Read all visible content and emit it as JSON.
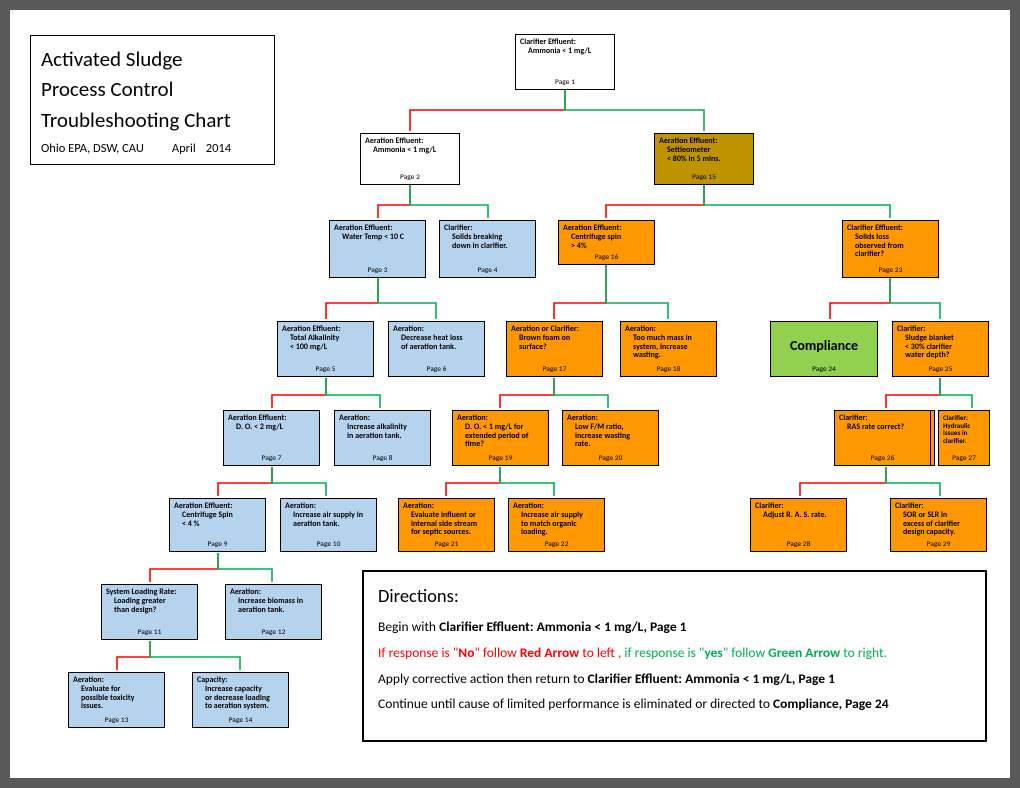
{
  "title": {
    "line1": "Activated Sludge",
    "line2": "Process Control",
    "line3": "Troubleshooting Chart",
    "sub_org": "Ohio EPA, DSW, CAU",
    "sub_month": "April",
    "sub_year": "2014"
  },
  "nodes": {
    "p1": {
      "hdr": "Clarifier Effluent:",
      "bd": "Ammonia < 1 mg/L",
      "pg": "Page 1"
    },
    "p2": {
      "hdr": "Aeration Effluent:",
      "bd": "Ammonia < 1 mg/L",
      "pg": "Page 2"
    },
    "p15": {
      "hdr": "Aeration Effluent:",
      "bd": "Settleometer",
      "bd2": "< 80% in 5 mins.",
      "pg": "Page 15"
    },
    "p3": {
      "hdr": "Aeration Effluent:",
      "bd": "Water Temp < 10 C",
      "pg": "Page 3"
    },
    "p4": {
      "hdr": "Clarifier:",
      "bd": "Solids breaking",
      "bd2": "down in clarifier.",
      "pg": "Page 4"
    },
    "p16": {
      "hdr": "Aeration Effluent:",
      "bd": "Centrifuge spin",
      "bd2": "> 4%",
      "pg": "Page 16"
    },
    "p23": {
      "hdr": "Clarifier Effluent:",
      "bd": "Solids loss",
      "bd2": "observed from",
      "bd3": "clarifier?",
      "pg": "Page 23"
    },
    "p5": {
      "hdr": "Aeration Effluent:",
      "bd": "Total Alkalinity",
      "bd2": "< 100 mg/L",
      "pg": "Page 5"
    },
    "p6": {
      "hdr": "Aeration:",
      "bd": "Decrease heat loss",
      "bd2": "of aeration tank.",
      "pg": "Page 6"
    },
    "p17": {
      "hdr": "Aeration or Clarifier:",
      "bd": "Brown foam on",
      "bd2": "surface?",
      "pg": "Page 17"
    },
    "p18": {
      "hdr": "Aeration:",
      "bd": "Too much mass in",
      "bd2": "system, increase",
      "bd3": "wasting.",
      "pg": "Page 18"
    },
    "p24": {
      "label": "Compliance",
      "pg": "Page 24"
    },
    "p25": {
      "hdr": "Clarifier:",
      "bd": "Sludge blanket",
      "bd2": "< 30% clarifier",
      "bd3": "water depth?",
      "pg": "Page 25"
    },
    "p7": {
      "hdr": "Aeration Effluent:",
      "bd": "D. O. < 2 mg/L",
      "pg": "Page 7"
    },
    "p8": {
      "hdr": "Aeration:",
      "bd": "Increase alkalinity",
      "bd2": "in aeration tank.",
      "pg": "Page 8"
    },
    "p19": {
      "hdr": "Aeration:",
      "bd": "D. O. < 1 mg/L for",
      "bd2": "extended period of",
      "bd3": "time?",
      "pg": "Page 19"
    },
    "p20": {
      "hdr": "Aeration:",
      "bd": "Low F/M ratio,",
      "bd2": "increase wasting",
      "bd3": "rate.",
      "pg": "Page 20"
    },
    "p26": {
      "hdr": "Clarifier:",
      "bd": "RAS rate correct?",
      "pg": "Page 26"
    },
    "p27": {
      "hdr": "Clarifier:",
      "bd": "Hydraulic issues in",
      "bd2": "clarifier.",
      "pg": "Page 27"
    },
    "p9": {
      "hdr": "Aeration Effluent:",
      "bd": "Centrifuge Spin",
      "bd2": "< 4 %",
      "pg": "Page 9"
    },
    "p10": {
      "hdr": "Aeration:",
      "bd": "Increase air supply in",
      "bd2": "aeration tank.",
      "pg": "Page 10"
    },
    "p21": {
      "hdr": "Aeration:",
      "bd": "Evaluate influent or",
      "bd2": "internal side stream",
      "bd3": "for septic sources.",
      "pg": "Page 21"
    },
    "p22": {
      "hdr": "Aeration:",
      "bd": "Increase air supply",
      "bd2": "to match organic",
      "bd3": "loading.",
      "pg": "Page 22"
    },
    "p28": {
      "hdr": "Clarifier:",
      "bd": "Adjust R. A. S. rate.",
      "pg": "Page 28"
    },
    "p29": {
      "hdr": "Clarifier:",
      "bd": "SOR or SLR in",
      "bd2": "excess of clarifier",
      "bd3": "design capacity.",
      "pg": "Page 29"
    },
    "p11": {
      "hdr": "System Loading Rate:",
      "bd": "Loading greater",
      "bd2": "than design?",
      "pg": "Page 11"
    },
    "p12": {
      "hdr": "Aeration:",
      "bd": "Increase biomass in",
      "bd2": "aeration tank.",
      "pg": "Page 12"
    },
    "p13": {
      "hdr": "Aeration:",
      "bd": "Evaluate for",
      "bd2": "possible toxicity",
      "bd3": "issues.",
      "pg": "Page 13"
    },
    "p14": {
      "hdr": "Capacity:",
      "bd": "Increase capacity",
      "bd2": "or decrease loading",
      "bd3": "to aeration system.",
      "pg": "Page 14"
    }
  },
  "directions": {
    "title": "Directions:",
    "l1_a": "Begin with ",
    "l1_b": "Clarifier Effluent: Ammonia < 1 mg/L, Page 1",
    "l2_a": "If response is \"",
    "l2_no": "No",
    "l2_b": "\" follow ",
    "l2_red": "Red Arrow",
    "l2_c": " to left ,",
    "l2_d": " if response is \"",
    "l2_yes": "yes",
    "l2_e": "\" follow ",
    "l2_grn": "Green Arrow",
    "l2_f": " to right.",
    "l3_a": "Apply corrective action then return to ",
    "l3_b": "Clarifier Effluent: Ammonia < 1 mg/L, Page 1",
    "l4_a": "Continue until cause of limited performance is eliminated or directed to ",
    "l4_b": "Compliance, Page 24"
  }
}
